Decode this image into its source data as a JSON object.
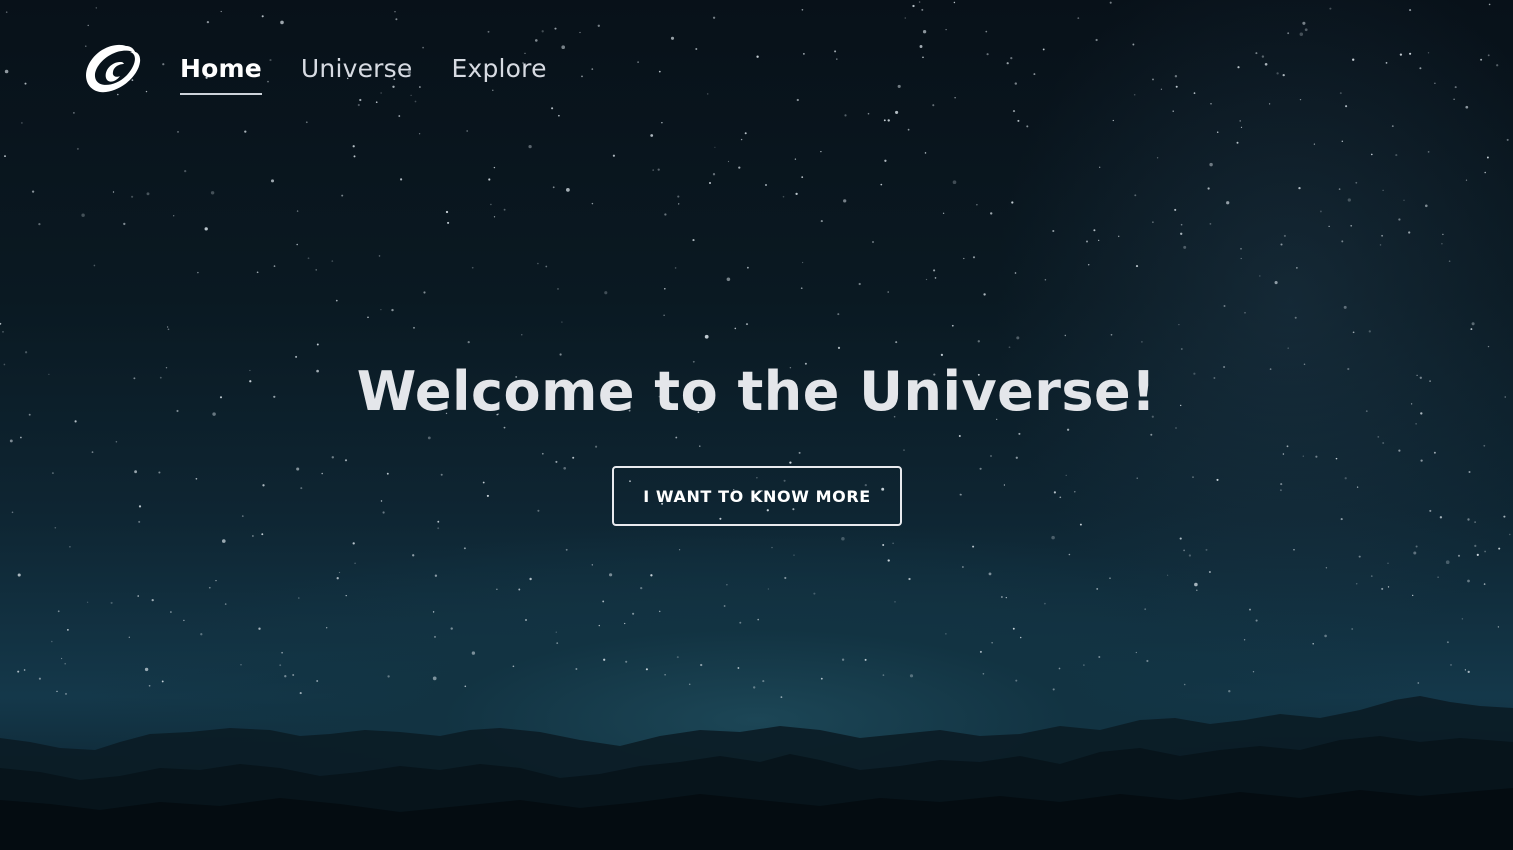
{
  "nav": {
    "logo_icon": "swirl-logo-icon",
    "items": [
      {
        "label": "Home",
        "active": true
      },
      {
        "label": "Universe",
        "active": false
      },
      {
        "label": "Explore",
        "active": false
      }
    ]
  },
  "hero": {
    "title": "Welcome to the Universe!",
    "cta_label": "I WANT TO KNOW MORE"
  },
  "background": {
    "description_icon": "starry-night-mountains-image"
  },
  "colors": {
    "text": "#e4e6ea",
    "sky_top": "#081119",
    "horizon_glow": "#1c4656",
    "mountains": "#050d12"
  }
}
